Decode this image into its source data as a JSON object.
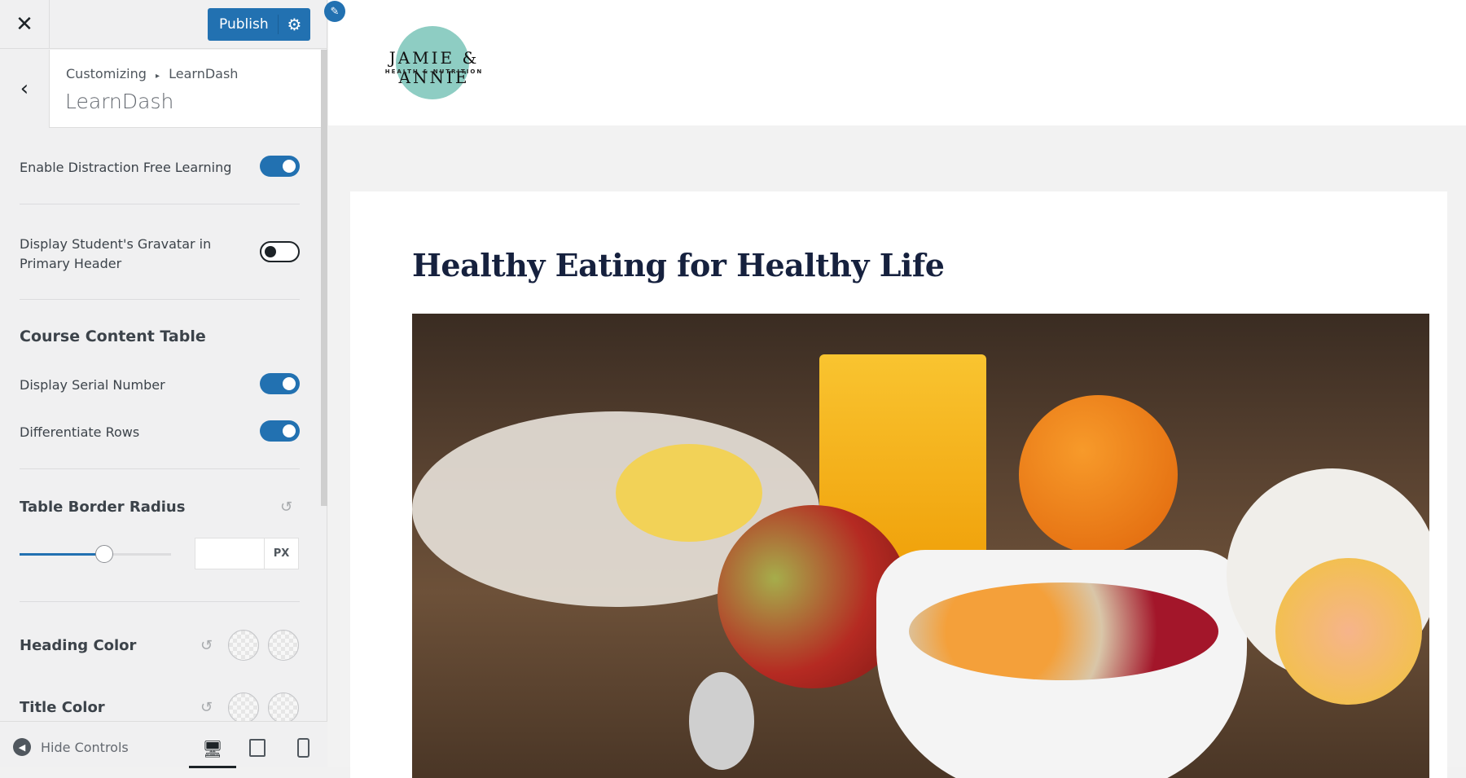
{
  "sidebar": {
    "close_icon": "close-icon",
    "publish_label": "Publish",
    "settings_icon": "gear-icon",
    "back_icon": "chevron-left-icon",
    "breadcrumb": {
      "root": "Customizing",
      "separator": "▸",
      "current": "LearnDash"
    },
    "section_title": "LearnDash",
    "controls": [
      {
        "label": "Enable Distraction Free Learning",
        "type": "toggle",
        "on": true
      },
      {
        "label": "Display Student's Gravatar in Primary Header",
        "type": "toggle",
        "on": false
      }
    ],
    "course_content_table": {
      "heading": "Course Content Table",
      "controls": [
        {
          "label": "Display Serial Number",
          "type": "toggle",
          "on": true
        },
        {
          "label": "Differentiate Rows",
          "type": "toggle",
          "on": true
        }
      ]
    },
    "table_border_radius": {
      "label": "Table Border Radius",
      "slider_fraction": 0.56,
      "value": "",
      "unit": "PX"
    },
    "heading_color": {
      "label": "Heading Color"
    },
    "title_color": {
      "label": "Title Color"
    },
    "footer": {
      "hide_controls": "Hide Controls",
      "devices": [
        "desktop",
        "tablet",
        "mobile"
      ],
      "active_device": "desktop"
    }
  },
  "preview": {
    "logo": {
      "name": "JAMIE & ANNIE",
      "tagline": "HEALTH & NUTRITION",
      "circle_color": "#8ecdc3"
    },
    "post_title": "Healthy Eating for Healthy Life",
    "accent": "#2271b1"
  }
}
